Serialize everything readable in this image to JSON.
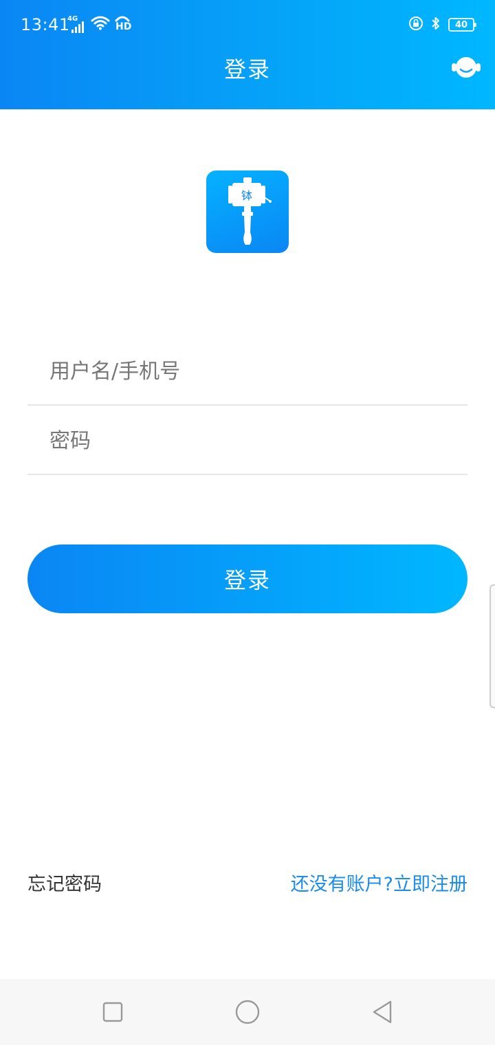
{
  "status_bar": {
    "time": "13:41",
    "network_type": "4G",
    "hd_label": "HD",
    "battery_level": "40",
    "icons": [
      "signal-4g-icon",
      "wifi-icon",
      "hd-call-icon",
      "rotation-lock-icon",
      "bluetooth-icon",
      "battery-icon"
    ]
  },
  "header": {
    "title": "登录",
    "support_icon": "customer-service-icon"
  },
  "logo": {
    "char": "钵"
  },
  "form": {
    "username_placeholder": "用户名/手机号",
    "username_value": "",
    "password_placeholder": "密码",
    "password_value": ""
  },
  "login_button_label": "登录",
  "footer_links": {
    "forgot_password": "忘记密码",
    "register": "还没有账户?立即注册"
  },
  "nav_bar": {
    "icons": [
      "recent-apps-icon",
      "home-icon",
      "back-icon"
    ]
  },
  "colors": {
    "brand_blue": "#0a86f4",
    "brand_cyan": "#00b7ff",
    "link_blue": "#1a8cf0"
  }
}
